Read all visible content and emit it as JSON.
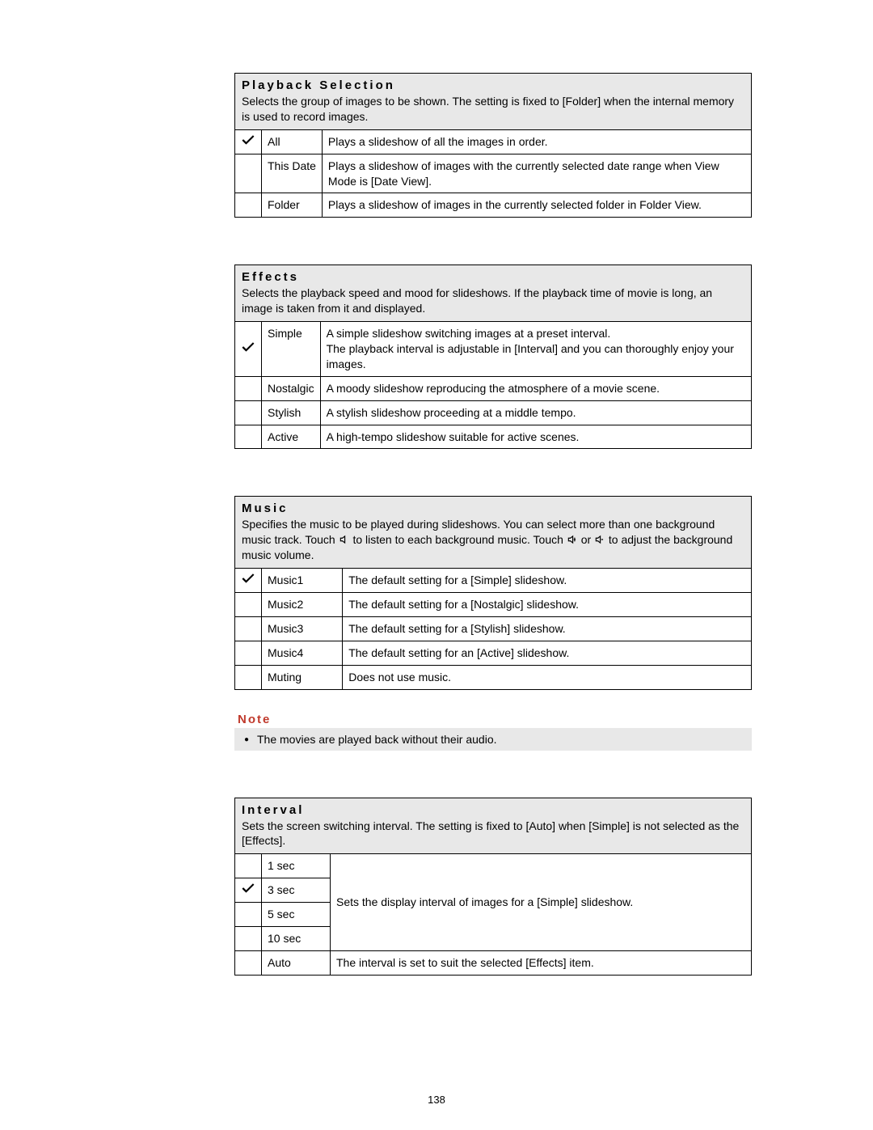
{
  "page_number": "138",
  "playback": {
    "title": "Playback Selection",
    "desc": "Selects the group of images to be shown. The setting is fixed to [Folder] when the internal memory is used to record images.",
    "rows": [
      {
        "checked": true,
        "name": "All",
        "desc": "Plays a slideshow of all the images in order."
      },
      {
        "checked": false,
        "name": "This Date",
        "desc": "Plays a slideshow of images with the currently selected date range when View Mode is [Date View]."
      },
      {
        "checked": false,
        "name": "Folder",
        "desc": "Plays a slideshow of images in the currently selected folder in Folder View."
      }
    ]
  },
  "effects": {
    "title": "Effects",
    "desc": "Selects the playback speed and mood for slideshows. If the playback time of movie is long, an image is taken from it and displayed.",
    "rows": [
      {
        "checked": true,
        "name": "Simple",
        "desc": "A simple slideshow switching images at a preset interval.\nThe playback interval is adjustable in [Interval] and you can thoroughly enjoy your images."
      },
      {
        "checked": false,
        "name": "Nostalgic",
        "desc": "A moody slideshow reproducing the atmosphere of a movie scene."
      },
      {
        "checked": false,
        "name": "Stylish",
        "desc": "A stylish slideshow proceeding at a middle tempo."
      },
      {
        "checked": false,
        "name": "Active",
        "desc": "A high-tempo slideshow suitable for active scenes."
      }
    ]
  },
  "music": {
    "title": "Music",
    "desc_pre": "Specifies the music to be played during slideshows. You can select more than one background music track. Touch ",
    "desc_mid1": " to listen to each background music. Touch ",
    "desc_mid2": " or ",
    "desc_post": " to adjust the background music volume.",
    "rows": [
      {
        "checked": true,
        "name": "Music1",
        "desc": "The default setting for a [Simple] slideshow."
      },
      {
        "checked": false,
        "name": "Music2",
        "desc": "The default setting for a [Nostalgic] slideshow."
      },
      {
        "checked": false,
        "name": "Music3",
        "desc": "The default setting for a [Stylish] slideshow."
      },
      {
        "checked": false,
        "name": "Music4",
        "desc": "The default setting for an [Active] slideshow."
      },
      {
        "checked": false,
        "name": "Muting",
        "desc": "Does not use music."
      }
    ]
  },
  "note": {
    "title": "Note",
    "text": "The movies are played back without their audio."
  },
  "interval": {
    "title": "Interval",
    "desc": "Sets the screen switching interval. The setting is fixed to [Auto] when [Simple] is not selected as the [Effects].",
    "group_desc": "Sets the display interval of images for a [Simple] slideshow.",
    "rows": [
      {
        "checked": false,
        "name": "1 sec"
      },
      {
        "checked": true,
        "name": "3 sec"
      },
      {
        "checked": false,
        "name": "5 sec"
      },
      {
        "checked": false,
        "name": "10 sec"
      }
    ],
    "auto_row": {
      "checked": false,
      "name": "Auto",
      "desc": "The interval is set to suit the selected [Effects] item."
    }
  }
}
